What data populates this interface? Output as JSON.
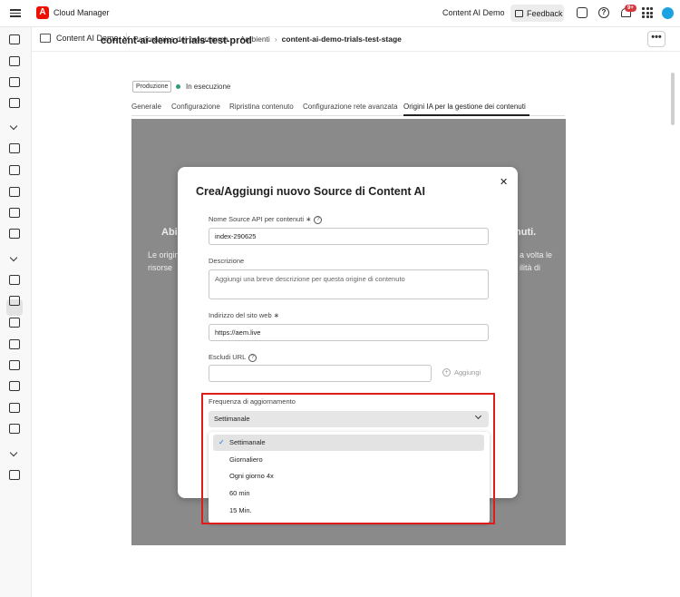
{
  "topbar": {
    "app_title": "Cloud Manager",
    "org_name": "Content AI Demo",
    "feedback_label": "Feedback",
    "notification_count": "9+"
  },
  "header": {
    "program_name": "Content AI Demo",
    "breadcrumb": [
      "Panoramica del programma",
      "Ambienti",
      "content-ai-demo-trials-test-stage"
    ],
    "more_label": "•••"
  },
  "environment": {
    "title": "content-ai-demo-trials-test-prod",
    "tag": "Produzione",
    "status": "In esecuzione",
    "status_color": "#2d9d78"
  },
  "tabs": [
    {
      "label": "Generale"
    },
    {
      "label": "Configurazione"
    },
    {
      "label": "Ripristina contenuto"
    },
    {
      "label": "Configurazione rete avanzata"
    },
    {
      "label": "Origini IA per la gestione dei contenuti"
    }
  ],
  "background_fragments": {
    "left_title": "Abi",
    "right_title": "nuti.",
    "left_line1": "Le origini",
    "left_line2": "risorse",
    "right_line1": "a volta le",
    "right_line2": "ilità di"
  },
  "modal": {
    "title": "Crea/Aggiungi nuovo Source di Content AI",
    "close_label": "✕",
    "api_name_label": "Nome Source API per contenuti ∗",
    "api_name_value": "index-290625",
    "description_label": "Descrizione",
    "description_placeholder": "Aggiungi una breve descrizione per questa origine di contenuto",
    "website_label": "Indirizzo del sito web ∗",
    "website_value": "https://aem.live",
    "exclude_label": "Escludi URL",
    "exclude_value": "",
    "add_label": "Aggiungi",
    "frequency_label": "Frequenza di aggiornamento",
    "frequency_value": "Settimanale",
    "frequency_options": [
      "Settimanale",
      "Giornaliero",
      "Ogni giorno 4x",
      "60 min",
      "15 Min."
    ],
    "help_glyph": "?"
  },
  "colors": {
    "accent": "#1473e6",
    "brand": "#eb1000",
    "highlight": "#e01b1b"
  }
}
